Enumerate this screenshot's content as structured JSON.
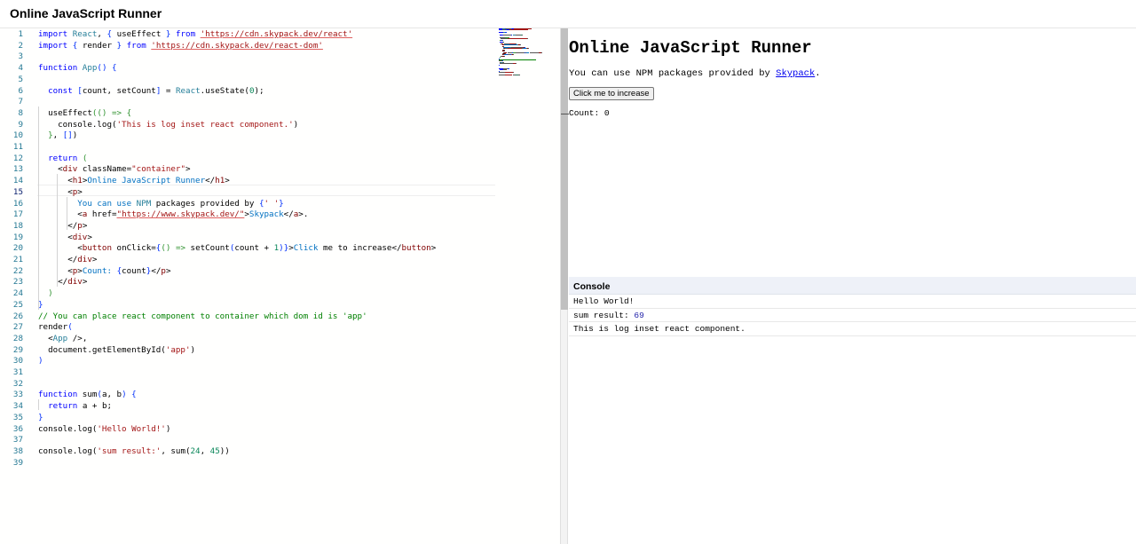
{
  "app": {
    "title": "Online JavaScript Runner"
  },
  "editor": {
    "active_line": 15,
    "lines": [
      [
        [
          "kw",
          "import "
        ],
        [
          "id",
          "React"
        ],
        [
          "plain",
          ", "
        ],
        [
          "brk",
          "{ "
        ],
        [
          "plain",
          "useEffect "
        ],
        [
          "brk",
          "}"
        ],
        [
          "kw",
          " from "
        ],
        [
          "url",
          "'https://cdn.skypack.dev/react'"
        ]
      ],
      [
        [
          "kw",
          "import "
        ],
        [
          "brk",
          "{ "
        ],
        [
          "plain",
          "render "
        ],
        [
          "brk",
          "}"
        ],
        [
          "kw",
          " from "
        ],
        [
          "url",
          "'https://cdn.skypack.dev/react-dom'"
        ]
      ],
      [],
      [
        [
          "kw",
          "function "
        ],
        [
          "id",
          "App"
        ],
        [
          "brk",
          "() {"
        ]
      ],
      [],
      [
        [
          "plain",
          "  "
        ],
        [
          "kw",
          "const "
        ],
        [
          "brk",
          "["
        ],
        [
          "plain",
          "count, setCount"
        ],
        [
          "brk",
          "]"
        ],
        [
          "plain",
          " = "
        ],
        [
          "id",
          "React"
        ],
        [
          "plain",
          ".useState("
        ],
        [
          "num",
          "0"
        ],
        [
          "plain",
          ");"
        ]
      ],
      [],
      [
        [
          "plain",
          "  useEffect"
        ],
        [
          "brk2",
          "(() => {"
        ]
      ],
      [
        [
          "plain",
          "    console.log("
        ],
        [
          "str",
          "'This is log inset react component.'"
        ],
        [
          "plain",
          ")"
        ]
      ],
      [
        [
          "brk2",
          "  }"
        ],
        [
          "plain",
          ", "
        ],
        [
          "brk",
          "[]"
        ],
        [
          "plain",
          ")"
        ]
      ],
      [],
      [
        [
          "plain",
          "  "
        ],
        [
          "kw",
          "return "
        ],
        [
          "brk2",
          "("
        ]
      ],
      [
        [
          "plain",
          "    <"
        ],
        [
          "tag",
          "div"
        ],
        [
          "plain",
          " className="
        ],
        [
          "str",
          "\"container\""
        ],
        [
          "plain",
          ">"
        ]
      ],
      [
        [
          "plain",
          "      <"
        ],
        [
          "tag",
          "h1"
        ],
        [
          "plain",
          ">"
        ],
        [
          "jsx",
          "Online JavaScript Runner"
        ],
        [
          "plain",
          "</"
        ],
        [
          "tag",
          "h1"
        ],
        [
          "plain",
          ">"
        ]
      ],
      [
        [
          "plain",
          "      <"
        ],
        [
          "tag",
          "p"
        ],
        [
          "plain",
          ">"
        ]
      ],
      [
        [
          "plain",
          "        "
        ],
        [
          "jsx",
          "You can use "
        ],
        [
          "id",
          "NPM"
        ],
        [
          "plain",
          " packages provided by "
        ],
        [
          "brk",
          "{"
        ],
        [
          "str",
          "' '"
        ],
        [
          "brk",
          "}"
        ]
      ],
      [
        [
          "plain",
          "        <"
        ],
        [
          "tag",
          "a"
        ],
        [
          "plain",
          " href="
        ],
        [
          "url",
          "\"https://www.skypack.dev/\""
        ],
        [
          "plain",
          ">"
        ],
        [
          "jsx",
          "Skypack"
        ],
        [
          "plain",
          "</"
        ],
        [
          "tag",
          "a"
        ],
        [
          "plain",
          ">."
        ]
      ],
      [
        [
          "plain",
          "      </"
        ],
        [
          "tag",
          "p"
        ],
        [
          "plain",
          ">"
        ]
      ],
      [
        [
          "plain",
          "      <"
        ],
        [
          "tag",
          "div"
        ],
        [
          "plain",
          ">"
        ]
      ],
      [
        [
          "plain",
          "        <"
        ],
        [
          "tag",
          "button"
        ],
        [
          "plain",
          " onClick="
        ],
        [
          "brk",
          "{"
        ],
        [
          "brk2",
          "() => "
        ],
        [
          "plain",
          "setCount"
        ],
        [
          "brk",
          "("
        ],
        [
          "plain",
          "count + "
        ],
        [
          "num",
          "1"
        ],
        [
          "brk",
          ")}"
        ],
        [
          "plain",
          ">"
        ],
        [
          "jsx",
          "Click"
        ],
        [
          "plain",
          " me to increase</"
        ],
        [
          "tag",
          "button"
        ],
        [
          "plain",
          ">"
        ]
      ],
      [
        [
          "plain",
          "      </"
        ],
        [
          "tag",
          "div"
        ],
        [
          "plain",
          ">"
        ]
      ],
      [
        [
          "plain",
          "      <"
        ],
        [
          "tag",
          "p"
        ],
        [
          "plain",
          ">"
        ],
        [
          "jsx",
          "Count: "
        ],
        [
          "brk",
          "{"
        ],
        [
          "plain",
          "count"
        ],
        [
          "brk",
          "}"
        ],
        [
          "plain",
          "</"
        ],
        [
          "tag",
          "p"
        ],
        [
          "plain",
          ">"
        ]
      ],
      [
        [
          "plain",
          "    </"
        ],
        [
          "tag",
          "div"
        ],
        [
          "plain",
          ">"
        ]
      ],
      [
        [
          "brk2",
          "  )"
        ]
      ],
      [
        [
          "brk",
          "}"
        ]
      ],
      [
        [
          "com",
          "// You can place react component to container which dom id is 'app'"
        ]
      ],
      [
        [
          "plain",
          "render"
        ],
        [
          "brk",
          "("
        ]
      ],
      [
        [
          "plain",
          "  <"
        ],
        [
          "id",
          "App"
        ],
        [
          "plain",
          " />,"
        ]
      ],
      [
        [
          "plain",
          "  document.getElementById("
        ],
        [
          "str",
          "'app'"
        ],
        [
          "plain",
          ")"
        ]
      ],
      [
        [
          "brk",
          ")"
        ]
      ],
      [],
      [],
      [
        [
          "kw",
          "function "
        ],
        [
          "plain",
          "sum"
        ],
        [
          "brk",
          "("
        ],
        [
          "plain",
          "a, b"
        ],
        [
          "brk",
          ") {"
        ]
      ],
      [
        [
          "plain",
          "  "
        ],
        [
          "kw",
          "return "
        ],
        [
          "plain",
          "a + b;"
        ]
      ],
      [
        [
          "brk",
          "}"
        ]
      ],
      [
        [
          "plain",
          "console.log("
        ],
        [
          "str",
          "'Hello World!'"
        ],
        [
          "plain",
          ")"
        ]
      ],
      [],
      [
        [
          "plain",
          "console.log("
        ],
        [
          "str",
          "'sum result:'"
        ],
        [
          "plain",
          ", sum("
        ],
        [
          "num",
          "24"
        ],
        [
          "plain",
          ", "
        ],
        [
          "num",
          "45"
        ],
        [
          "plain",
          "))"
        ]
      ],
      []
    ]
  },
  "preview": {
    "heading": "Online JavaScript Runner",
    "text": "You can use NPM packages provided by ",
    "link": "Skypack",
    "suffix": ".",
    "button": "Click me to increase",
    "count_label": "Count: ",
    "count_value": "0"
  },
  "console": {
    "title": "Console",
    "entries": [
      {
        "text": "Hello World!",
        "num": ""
      },
      {
        "text": "sum result: ",
        "num": "69"
      },
      {
        "text": "This is log inset react component.",
        "num": ""
      }
    ]
  },
  "colors": {
    "keyword": "#0000ff",
    "string": "#a31515",
    "comment": "#008000",
    "number": "#098658",
    "identifier": "#267f99",
    "line_number": "#237893",
    "console_header": "#eef1f8"
  }
}
